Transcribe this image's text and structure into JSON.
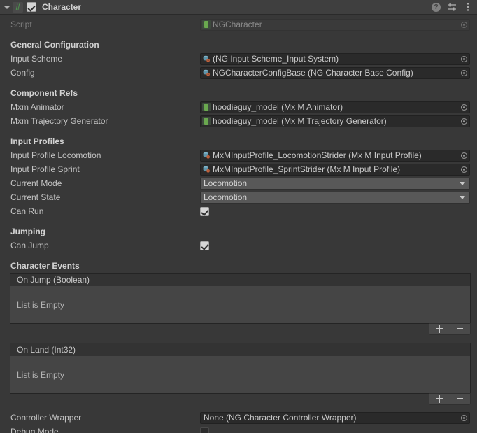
{
  "header": {
    "title": "Character",
    "enabled_checkbox": true,
    "script_icon": "csharp-script-icon",
    "help_icon": "help-icon",
    "preset_icon": "preset-icon",
    "menu_icon": "more-menu-icon",
    "foldout_icon": "foldout-triangle-icon"
  },
  "script_row": {
    "label": "Script",
    "value": "NGCharacter",
    "icon": "prefab-script-icon",
    "disabled": true
  },
  "sections": [
    {
      "title": "General Configuration",
      "rows": [
        {
          "label": "Input Scheme",
          "type": "object",
          "value": "(NG Input Scheme_Input System)",
          "icon": "scriptable-object-icon"
        },
        {
          "label": "Config",
          "type": "object",
          "value": "NGCharacterConfigBase (NG Character Base Config)",
          "icon": "scriptable-object-icon"
        }
      ]
    },
    {
      "title": "Component Refs",
      "rows": [
        {
          "label": "Mxm Animator",
          "type": "object",
          "value": "hoodieguy_model (Mx M Animator)",
          "icon": "prefab-icon"
        },
        {
          "label": "Mxm Trajectory Generator",
          "type": "object",
          "value": "hoodieguy_model (Mx M Trajectory Generator)",
          "icon": "prefab-icon"
        }
      ]
    },
    {
      "title": "Input Profiles",
      "rows": [
        {
          "label": "Input Profile Locomotion",
          "type": "object",
          "value": "MxMInputProfile_LocomotionStrider (Mx M Input Profile)",
          "icon": "scriptable-object-icon"
        },
        {
          "label": "Input Profile Sprint",
          "type": "object",
          "value": "MxMInputProfile_SprintStrider (Mx M Input Profile)",
          "icon": "scriptable-object-icon"
        },
        {
          "label": "Current Mode",
          "type": "dropdown",
          "value": "Locomotion"
        },
        {
          "label": "Current State",
          "type": "dropdown",
          "value": "Locomotion"
        },
        {
          "label": "Can Run",
          "type": "checkbox",
          "checked": true
        }
      ]
    },
    {
      "title": "Jumping",
      "rows": [
        {
          "label": "Can Jump",
          "type": "checkbox",
          "checked": true
        }
      ]
    }
  ],
  "character_events": {
    "title": "Character Events",
    "events": [
      {
        "header": "On Jump (Boolean)",
        "empty_text": "List is Empty",
        "add_label": "+",
        "remove_label": "−"
      },
      {
        "header": "On Land (Int32)",
        "empty_text": "List is Empty",
        "add_label": "+",
        "remove_label": "−"
      }
    ]
  },
  "footer_rows": [
    {
      "label": "Controller Wrapper",
      "type": "object",
      "value": "None (NG Character Controller Wrapper)",
      "icon": "none-object-icon"
    },
    {
      "label": "Debug Mode",
      "type": "checkbox",
      "checked": false
    }
  ],
  "colors": {
    "background": "#383838",
    "header_background": "#3f3f3f",
    "object_field": "#2a2a2a",
    "dropdown": "#585858",
    "event_body": "#454545",
    "text": "#c4c4c4"
  }
}
